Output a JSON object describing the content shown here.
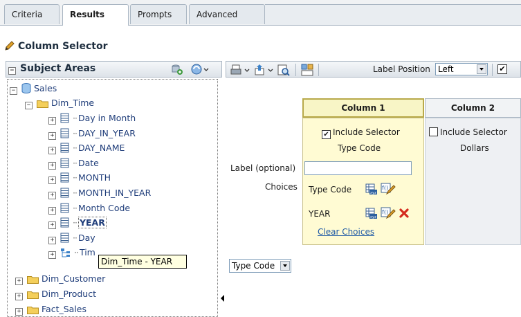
{
  "tabs": [
    "Criteria",
    "Results",
    "Prompts",
    "Advanced"
  ],
  "title": "Column Selector",
  "subject_areas": {
    "header": "Subject Areas",
    "root": "Sales",
    "dim_time": "Dim_Time",
    "columns": [
      "Day in Month",
      "DAY_IN_YEAR",
      "DAY_NAME",
      "Date",
      "MONTH",
      "MONTH_IN_YEAR",
      "Month Code",
      "YEAR",
      "Day",
      "Tim"
    ],
    "folders": [
      "Dim_Customer",
      "Dim_Product",
      "Fact_Sales"
    ]
  },
  "tooltip": "Dim_Time - YEAR",
  "toolbar": {
    "label_position_label": "Label Position",
    "label_position_value": "Left"
  },
  "selector": {
    "column1": {
      "header": "Column 1",
      "include_label": "Include Selector",
      "include_checked": true,
      "column_name": "Type Code",
      "choices": [
        "Type Code",
        "YEAR"
      ],
      "clear_choices": "Clear Choices"
    },
    "column2": {
      "header": "Column 2",
      "include_label": "Include Selector",
      "include_checked": false,
      "column_name": "Dollars"
    },
    "label_optional": "Label (optional)",
    "choices_label": "Choices"
  },
  "preview_dropdown": "Type Code",
  "colors": {
    "accent_yellow": "#fffbd3",
    "link_blue": "#1f5aa6",
    "tree_text": "#1f3d7a",
    "delete_red": "#d42a1e"
  }
}
